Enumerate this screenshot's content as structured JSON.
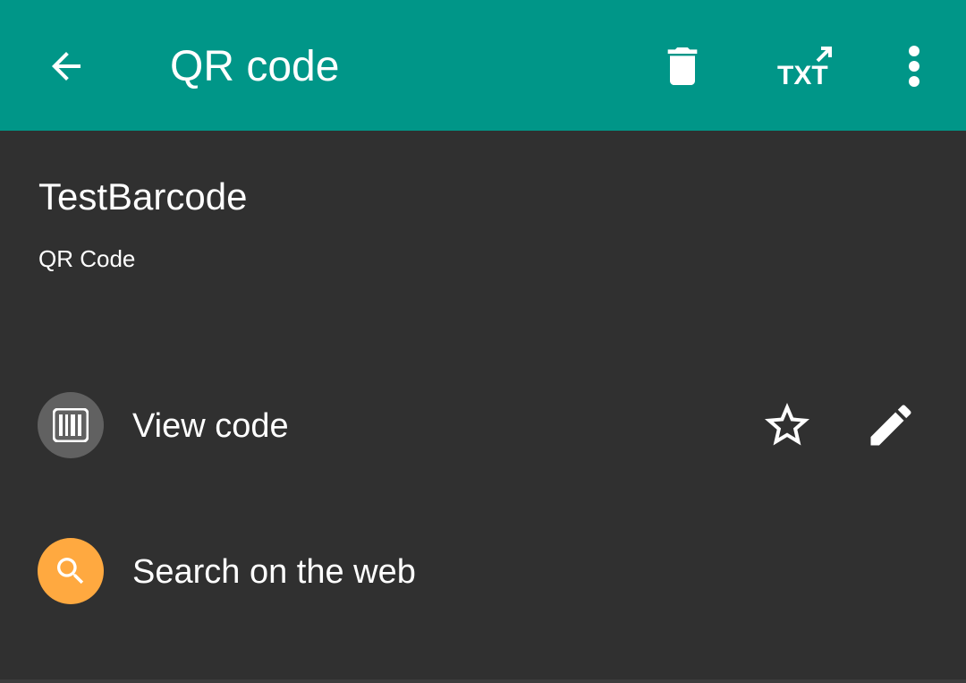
{
  "colors": {
    "app_bar": "#009688",
    "background": "#303030",
    "view_code_circle": "#616161",
    "search_circle": "#FFA940",
    "text": "#FFFFFF"
  },
  "app_bar": {
    "title": "QR code",
    "back_icon": "arrow-back-icon",
    "delete_icon": "trash-icon",
    "export_text_icon": "txt-export-icon",
    "more_icon": "more-vert-icon"
  },
  "barcode": {
    "text": "TestBarcode",
    "format": "QR Code"
  },
  "actions": [
    {
      "label": "View code",
      "icon": "barcode-icon"
    },
    {
      "label": "Search on the web",
      "icon": "search-icon"
    }
  ],
  "row_actions": {
    "favorite_icon": "star-outline-icon",
    "edit_icon": "pencil-icon"
  }
}
